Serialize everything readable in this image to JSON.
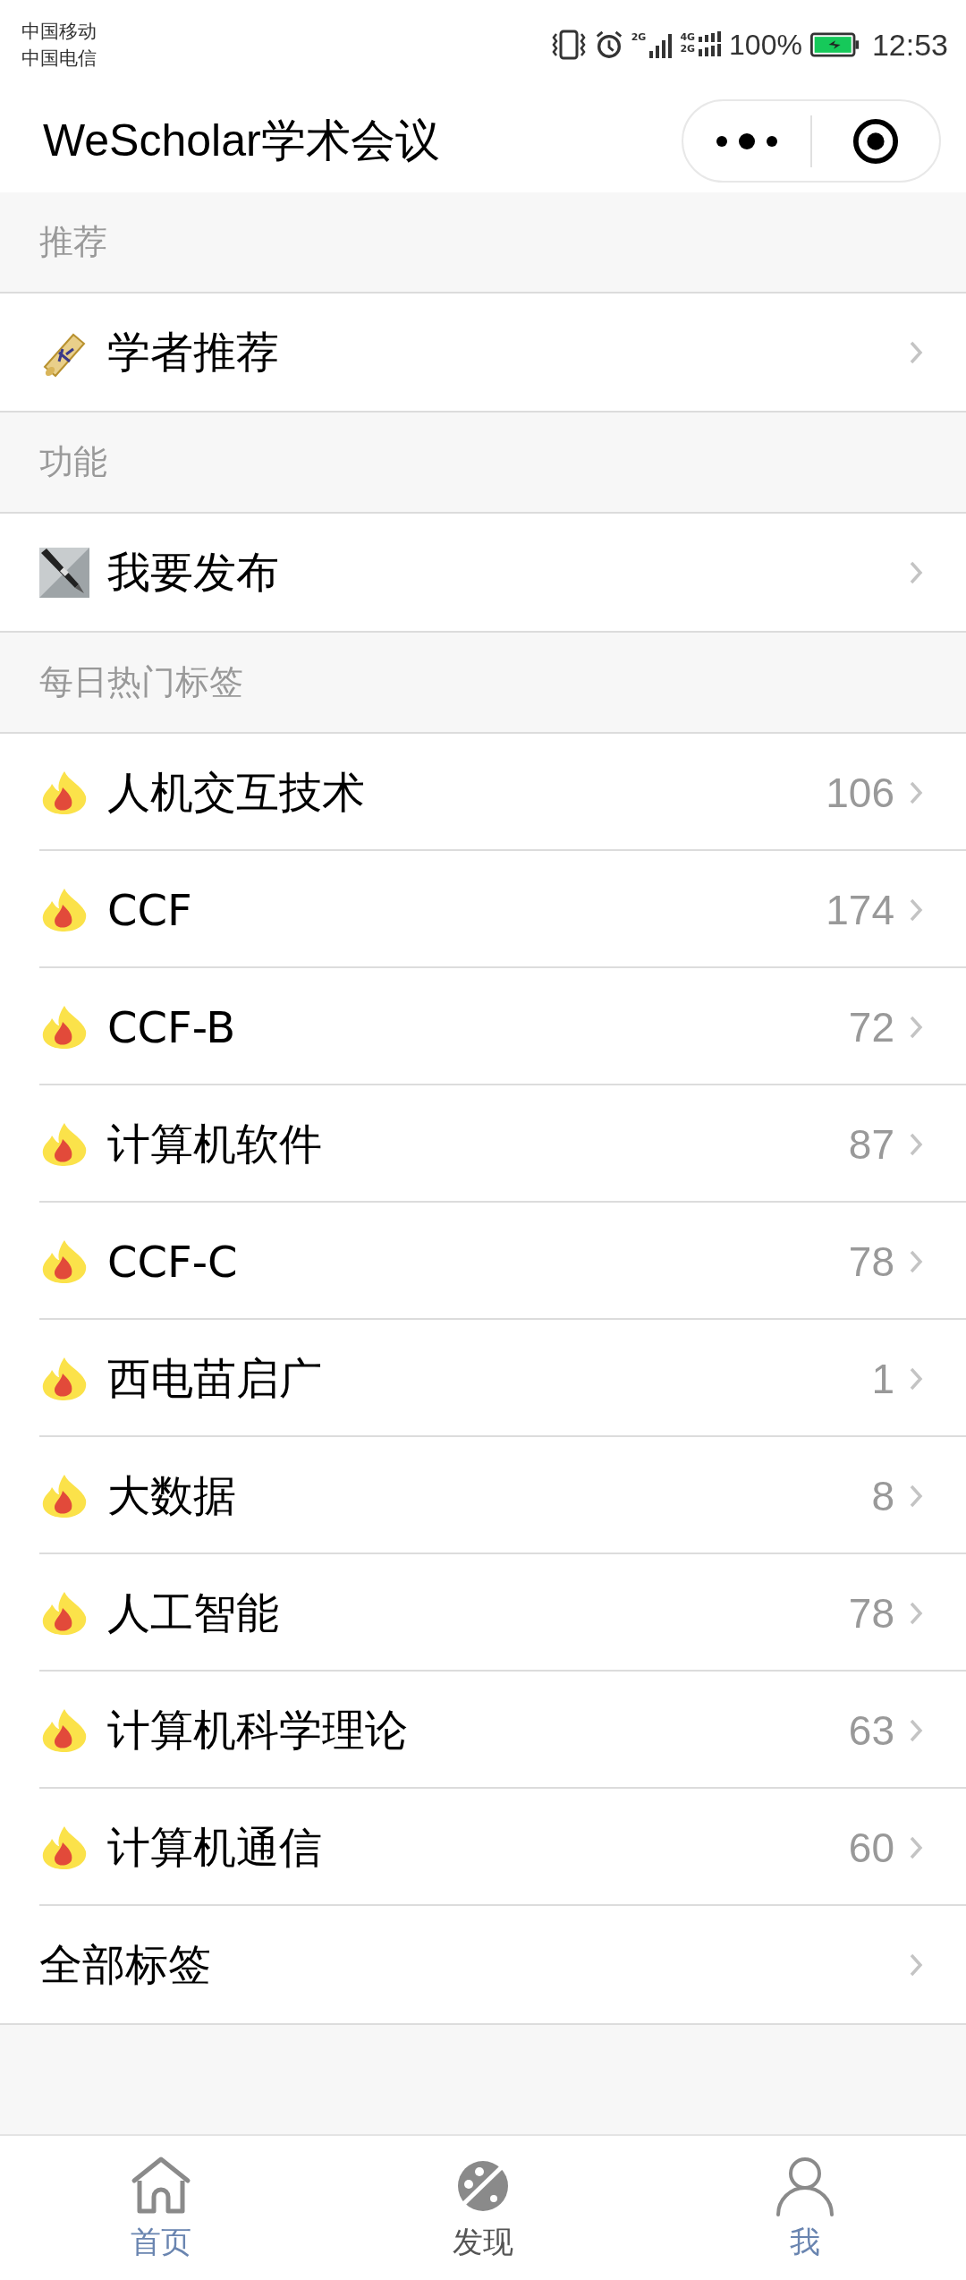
{
  "status_bar": {
    "carriers": [
      "中国移动",
      "中国电信"
    ],
    "networks": [
      "2G",
      "4G",
      "2G"
    ],
    "battery": "100%",
    "time": "12:53"
  },
  "header": {
    "title": "WeScholar学术会议"
  },
  "sections": [
    {
      "title": "推荐",
      "items": [
        {
          "kind": "scholar",
          "label": "学者推荐"
        }
      ]
    },
    {
      "title": "功能",
      "items": [
        {
          "kind": "publish",
          "label": "我要发布"
        }
      ]
    },
    {
      "title": "每日热门标签",
      "items": [
        {
          "kind": "tag",
          "label": "人机交互技术",
          "count": "106"
        },
        {
          "kind": "tag",
          "label": "CCF",
          "count": "174"
        },
        {
          "kind": "tag",
          "label": "CCF-B",
          "count": "72"
        },
        {
          "kind": "tag",
          "label": "计算机软件",
          "count": "87"
        },
        {
          "kind": "tag",
          "label": "CCF-C",
          "count": "78"
        },
        {
          "kind": "tag",
          "label": "西电苗启广",
          "count": "1"
        },
        {
          "kind": "tag",
          "label": "大数据",
          "count": "8"
        },
        {
          "kind": "tag",
          "label": "人工智能",
          "count": "78"
        },
        {
          "kind": "tag",
          "label": "计算机科学理论",
          "count": "63"
        },
        {
          "kind": "tag",
          "label": "计算机通信",
          "count": "60"
        },
        {
          "kind": "plain",
          "label": "全部标签"
        }
      ]
    }
  ],
  "tab_bar": [
    {
      "kind": "home",
      "label": "首页",
      "selected": false
    },
    {
      "kind": "discover",
      "label": "发现",
      "selected": true
    },
    {
      "kind": "me",
      "label": "我",
      "selected": false
    }
  ]
}
